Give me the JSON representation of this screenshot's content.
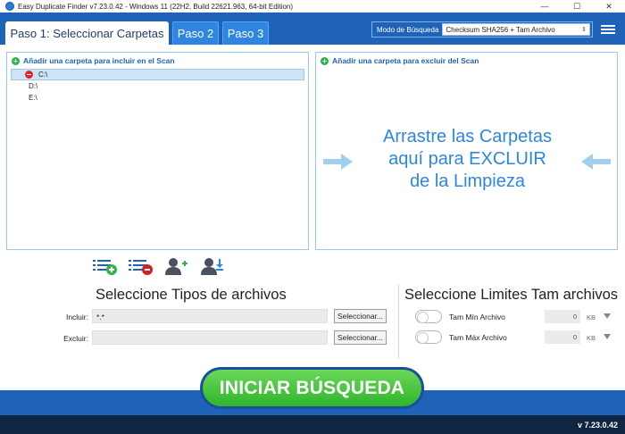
{
  "window": {
    "title": "Easy Duplicate Finder v7.23.0.42 - Windows 11 (22H2, Build 22621.963, 64-bit Edition)",
    "minimize": "—",
    "maximize": "☐",
    "close": "✕"
  },
  "tabs": [
    {
      "label": "Paso 1: Seleccionar Carpetas"
    },
    {
      "label": "Paso 2"
    },
    {
      "label": "Paso 3"
    }
  ],
  "mode": {
    "label": "Modo de Búsqueda",
    "value": "Checksum SHA256 + Tam Archivo"
  },
  "include_panel": {
    "header": "Añadir una carpeta para incluir en el Scan",
    "folders": [
      "C:\\",
      "D:\\",
      "E:\\"
    ]
  },
  "exclude_panel": {
    "header": "Añadir una carpeta para excluir del Scan",
    "drop_message_line1": "Arrastre las Carpetas",
    "drop_message_line2": "aquí para EXCLUIR",
    "drop_message_line3": "de la Limpieza"
  },
  "file_types": {
    "title": "Seleccione Tipos de archivos",
    "include_label": "Incluir:",
    "include_value": "*.*",
    "exclude_label": "Excluir:",
    "exclude_value": "",
    "select_button": "Seleccionar..."
  },
  "size_limits": {
    "title": "Seleccione Limites Tam archivos",
    "min_label": "Tam Mín Archivo",
    "min_value": "0",
    "max_label": "Tam Máx Archivo",
    "max_value": "0",
    "unit": "KB"
  },
  "start_button": "INICIAR BÚSQUEDA",
  "version": "v 7.23.0.42",
  "colors": {
    "brand_blue": "#1f63b8",
    "accent_green": "#2fb52a",
    "footer_dark": "#0f2542"
  }
}
